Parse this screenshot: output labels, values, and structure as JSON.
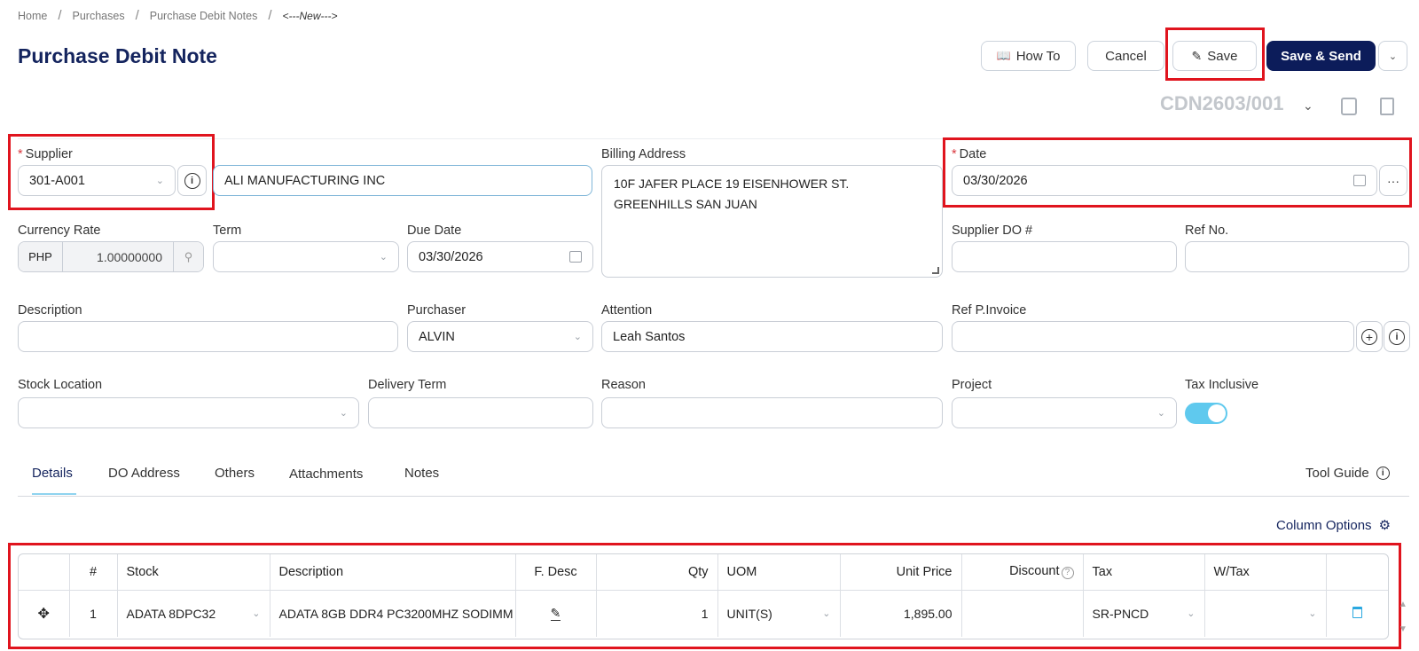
{
  "breadcrumb": {
    "items": [
      "Home",
      "Purchases",
      "Purchase Debit Notes"
    ],
    "current": "<---New--->",
    "separator": "/"
  },
  "page": {
    "title": "Purchase Debit Note"
  },
  "toolbar": {
    "howto_label": "How To",
    "cancel_label": "Cancel",
    "save_label": "Save",
    "save_send_label": "Save & Send"
  },
  "doc": {
    "number": "CDN2603/001"
  },
  "form": {
    "supplier": {
      "label": "Supplier",
      "code": "301-A001",
      "name": "ALI MANUFACTURING INC"
    },
    "billing_address": {
      "label": "Billing Address",
      "line1": "10F JAFER PLACE 19 EISENHOWER ST.",
      "line2": "GREENHILLS SAN JUAN"
    },
    "date": {
      "label": "Date",
      "value": "03/30/2026"
    },
    "currency_rate": {
      "label": "Currency Rate",
      "currency": "PHP",
      "rate": "1.00000000"
    },
    "term": {
      "label": "Term",
      "value": ""
    },
    "due_date": {
      "label": "Due Date",
      "value": "03/30/2026"
    },
    "supplier_do": {
      "label": "Supplier DO #",
      "value": ""
    },
    "ref_no": {
      "label": "Ref No.",
      "value": ""
    },
    "description": {
      "label": "Description",
      "value": ""
    },
    "purchaser": {
      "label": "Purchaser",
      "value": "ALVIN"
    },
    "attention": {
      "label": "Attention",
      "value": "Leah Santos"
    },
    "ref_pinvoice": {
      "label": "Ref P.Invoice",
      "value": ""
    },
    "stock_location": {
      "label": "Stock Location",
      "value": ""
    },
    "delivery_term": {
      "label": "Delivery Term",
      "value": ""
    },
    "reason": {
      "label": "Reason",
      "value": ""
    },
    "project": {
      "label": "Project",
      "value": ""
    },
    "tax_inclusive": {
      "label": "Tax Inclusive",
      "on": true
    }
  },
  "tabs": [
    "Details",
    "DO Address",
    "Others",
    "Attachments",
    "Notes"
  ],
  "tool_guide_label": "Tool Guide",
  "column_options_label": "Column Options",
  "table": {
    "headers": [
      "",
      "#",
      "Stock",
      "Description",
      "F. Desc",
      "Qty",
      "UOM",
      "Unit Price",
      "Discount",
      "Tax",
      "W/Tax",
      ""
    ],
    "rows": [
      {
        "num": "1",
        "stock": "ADATA 8DPC32",
        "description": "ADATA 8GB DDR4 PC3200MHZ SODIMM",
        "qty": "1",
        "uom": "UNIT(S)",
        "unit_price": "1,895.00",
        "discount": "",
        "tax": "SR-PNCD",
        "wtax": ""
      }
    ]
  },
  "colors": {
    "accent": "#14245e",
    "highlight": "#e0141e",
    "toggle": "#5fc9ee",
    "link": "#14245e"
  }
}
